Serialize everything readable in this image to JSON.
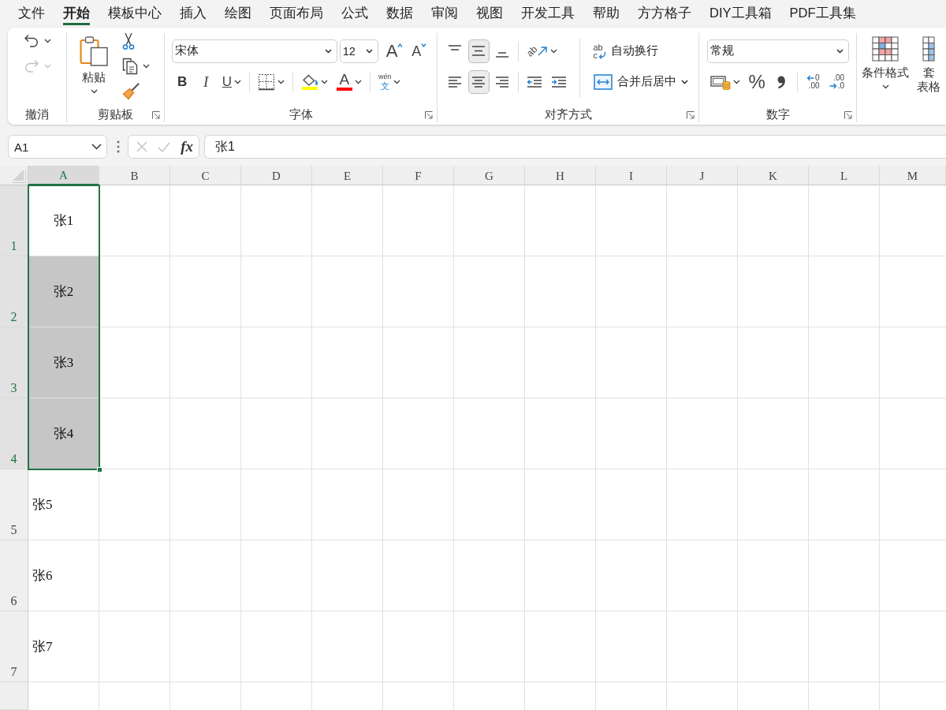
{
  "menu_tabs": [
    {
      "label": "文件",
      "selected": false
    },
    {
      "label": "开始",
      "selected": true
    },
    {
      "label": "模板中心",
      "selected": false
    },
    {
      "label": "插入",
      "selected": false
    },
    {
      "label": "绘图",
      "selected": false
    },
    {
      "label": "页面布局",
      "selected": false
    },
    {
      "label": "公式",
      "selected": false
    },
    {
      "label": "数据",
      "selected": false
    },
    {
      "label": "审阅",
      "selected": false
    },
    {
      "label": "视图",
      "selected": false
    },
    {
      "label": "开发工具",
      "selected": false
    },
    {
      "label": "帮助",
      "selected": false
    },
    {
      "label": "方方格子",
      "selected": false
    },
    {
      "label": "DIY工具箱",
      "selected": false
    },
    {
      "label": "PDF工具集",
      "selected": false
    }
  ],
  "ribbon": {
    "groups": [
      {
        "label": "撤消",
        "launcher": false,
        "blocks": [
          {
            "kind": "icon_column",
            "items": [
              {
                "kind": "undo",
                "dropdown": true,
                "disabled": false
              },
              {
                "kind": "redo",
                "dropdown": true,
                "disabled": true
              }
            ]
          }
        ]
      },
      {
        "label": "剪贴板",
        "launcher": true,
        "blocks": [
          {
            "kind": "large",
            "button": {
              "kind": "paste",
              "label_lines": [
                "粘贴"
              ],
              "dropdown": true
            }
          },
          {
            "kind": "icon_column",
            "items": [
              {
                "kind": "cut",
                "dropdown": false
              },
              {
                "kind": "copy",
                "dropdown": true
              },
              {
                "kind": "format_painter",
                "dropdown": false
              }
            ]
          }
        ]
      },
      {
        "label": "字体",
        "launcher": true,
        "blocks": [
          {
            "kind": "rows",
            "rows": [
              [
                {
                  "kind": "font_name",
                  "value": "宋体"
                },
                {
                  "kind": "font_size",
                  "value": "12"
                },
                {
                  "kind": "font_grow",
                  "glyph": "A",
                  "dropdown": false
                },
                {
                  "kind": "font_shrink",
                  "glyph": "A",
                  "dropdown": false
                }
              ],
              [
                {
                  "kind": "bold",
                  "glyph": "B",
                  "dropdown": false
                },
                {
                  "kind": "italic",
                  "glyph": "I",
                  "dropdown": false
                },
                {
                  "kind": "underline",
                  "glyph": "U",
                  "dropdown": true
                },
                {
                  "kind": "separator"
                },
                {
                  "kind": "borders",
                  "dropdown": true
                },
                {
                  "kind": "separator"
                },
                {
                  "kind": "fill_color",
                  "color": "#ffff00",
                  "dropdown": true
                },
                {
                  "kind": "font_color",
                  "glyph": "A",
                  "color": "#ff0000",
                  "dropdown": true
                },
                {
                  "kind": "separator"
                },
                {
                  "kind": "phonetic",
                  "glyphs": [
                    "wén",
                    "文"
                  ],
                  "dropdown": true
                }
              ]
            ]
          }
        ]
      },
      {
        "label": "对齐方式",
        "launcher": true,
        "blocks": [
          {
            "kind": "rows",
            "rows": [
              [
                {
                  "kind": "align_top",
                  "selected": false,
                  "dropdown": false
                },
                {
                  "kind": "align_middle",
                  "selected": true,
                  "dropdown": false
                },
                {
                  "kind": "align_bottom",
                  "selected": false,
                  "dropdown": false
                },
                {
                  "kind": "separator"
                },
                {
                  "kind": "orientation",
                  "glyph": "ab",
                  "dropdown": true
                }
              ],
              [
                {
                  "kind": "align_left",
                  "selected": false,
                  "dropdown": false
                },
                {
                  "kind": "align_center",
                  "selected": true,
                  "dropdown": false
                },
                {
                  "kind": "align_right",
                  "selected": false,
                  "dropdown": false
                },
                {
                  "kind": "separator"
                },
                {
                  "kind": "indent_decrease",
                  "dropdown": false
                },
                {
                  "kind": "indent_increase",
                  "dropdown": false
                }
              ]
            ]
          },
          {
            "kind": "separator"
          },
          {
            "kind": "rows",
            "rows": [
              [
                {
                  "kind": "wrap_text",
                  "glyphs": [
                    "ab",
                    "c"
                  ],
                  "label": "自动换行",
                  "dropdown": false
                }
              ],
              [
                {
                  "kind": "merge_center",
                  "label": "合并后居中",
                  "dropdown": true
                }
              ]
            ]
          }
        ]
      },
      {
        "label": "数字",
        "launcher": true,
        "blocks": [
          {
            "kind": "rows",
            "rows": [
              [
                {
                  "kind": "number_format",
                  "value": "常规"
                }
              ],
              [
                {
                  "kind": "accounting",
                  "dropdown": true
                },
                {
                  "kind": "percent",
                  "glyph": "%",
                  "dropdown": false
                },
                {
                  "kind": "comma_style",
                  "dropdown": false
                },
                {
                  "kind": "separator"
                },
                {
                  "kind": "decimal_increase",
                  "glyphs": [
                    "0",
                    ".00"
                  ],
                  "dropdown": false
                },
                {
                  "kind": "decimal_decrease",
                  "glyphs": [
                    ".00",
                    ".0"
                  ],
                  "dropdown": false
                }
              ]
            ]
          }
        ]
      },
      {
        "blocks": [
          {
            "kind": "large",
            "button": {
              "kind": "conditional_format",
              "label_lines": [
                "条件格式"
              ],
              "dropdown": true
            }
          },
          {
            "kind": "large",
            "button": {
              "kind": "table_format",
              "label_lines": [
                "套",
                "表格"
              ]
            }
          }
        ]
      }
    ]
  },
  "formula_bar": {
    "name_box": "A1",
    "cancel": {
      "disabled": true
    },
    "confirm": {
      "disabled": true
    },
    "function_glyph": "fx",
    "formula": "张1"
  },
  "sheet": {
    "columns": [
      {
        "label": "A",
        "selected": true
      },
      {
        "label": "B",
        "selected": false
      },
      {
        "label": "C",
        "selected": false
      },
      {
        "label": "D",
        "selected": false
      },
      {
        "label": "E",
        "selected": false
      },
      {
        "label": "F",
        "selected": false
      },
      {
        "label": "G",
        "selected": false
      },
      {
        "label": "H",
        "selected": false
      },
      {
        "label": "I",
        "selected": false
      },
      {
        "label": "J",
        "selected": false
      },
      {
        "label": "K",
        "selected": false
      },
      {
        "label": "L",
        "selected": false
      },
      {
        "label": "M",
        "selected": false
      }
    ],
    "rows": [
      {
        "label": "1",
        "selected": true,
        "cells": [
          {
            "text": "张1",
            "centered": true,
            "selected": true,
            "active": true
          }
        ]
      },
      {
        "label": "2",
        "selected": true,
        "cells": [
          {
            "text": "张2",
            "centered": true,
            "selected": true,
            "active": false
          }
        ]
      },
      {
        "label": "3",
        "selected": true,
        "cells": [
          {
            "text": "张3",
            "centered": true,
            "selected": true,
            "active": false
          }
        ]
      },
      {
        "label": "4",
        "selected": true,
        "cells": [
          {
            "text": "张4",
            "centered": true,
            "selected": true,
            "active": false
          }
        ]
      },
      {
        "label": "5",
        "selected": false,
        "cells": [
          {
            "text": "张5",
            "centered": false,
            "selected": false,
            "active": false
          }
        ]
      },
      {
        "label": "6",
        "selected": false,
        "cells": [
          {
            "text": "张6",
            "centered": false,
            "selected": false,
            "active": false
          }
        ]
      },
      {
        "label": "7",
        "selected": false,
        "cells": [
          {
            "text": "张7",
            "centered": false,
            "selected": false,
            "active": false
          }
        ]
      }
    ]
  }
}
